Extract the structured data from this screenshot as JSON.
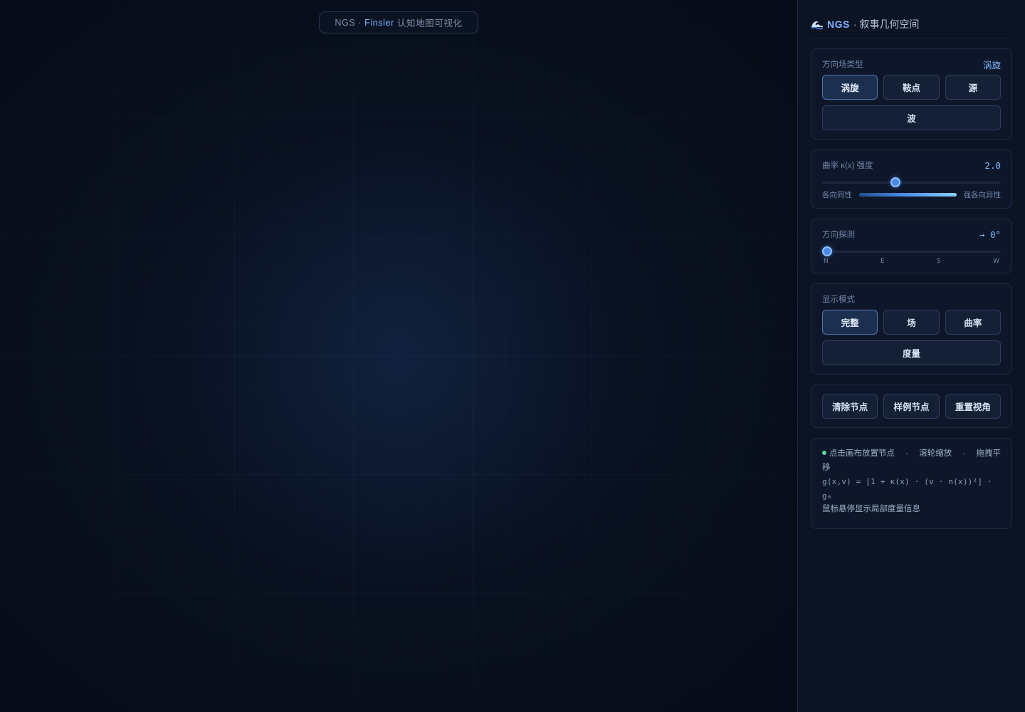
{
  "canvas": {
    "title_prefix": "NGS ·",
    "title_accent": "Finsler",
    "title_suffix": "认知地图可视化"
  },
  "sidebar": {
    "brand": "NGS",
    "subtitle": "· 叙事几何空间",
    "field_type": {
      "label": "方向场类型",
      "current": "涡旋",
      "options": [
        "涡旋",
        "鞍点",
        "源",
        "波"
      ],
      "selected_index": 0
    },
    "curvature": {
      "label": "曲率 κ(x) 强度",
      "value": "2.0",
      "fraction": 0.41,
      "min_label": "各向同性",
      "max_label": "强各向异性"
    },
    "direction": {
      "label": "方向探测",
      "value": "→ 0°",
      "fraction": 0.0,
      "ticks": [
        "N",
        "E",
        "S",
        "W"
      ]
    },
    "display_mode": {
      "label": "显示模式",
      "options": [
        "完整",
        "场",
        "曲率",
        "度量"
      ],
      "selected_index": 0
    },
    "actions": {
      "clear": "清除节点",
      "sample": "样例节点",
      "reset": "重置视角"
    },
    "info": {
      "hint_place": "点击画布放置节点",
      "sep1": "·",
      "hint_zoom": "滚轮缩放",
      "sep2": "·",
      "hint_pan_a": "拖拽平",
      "hint_pan_b": "移",
      "formula_a": "g(x,v) = [1 + κ(x) · (v · n(x))²] ·",
      "formula_b": "g₀",
      "hover_hint": "鼠标悬停显示局部度量信息"
    }
  },
  "colors": {
    "accent": "#7fb6ff",
    "background": "#0a1120",
    "status_dot": "#5fd69a"
  }
}
